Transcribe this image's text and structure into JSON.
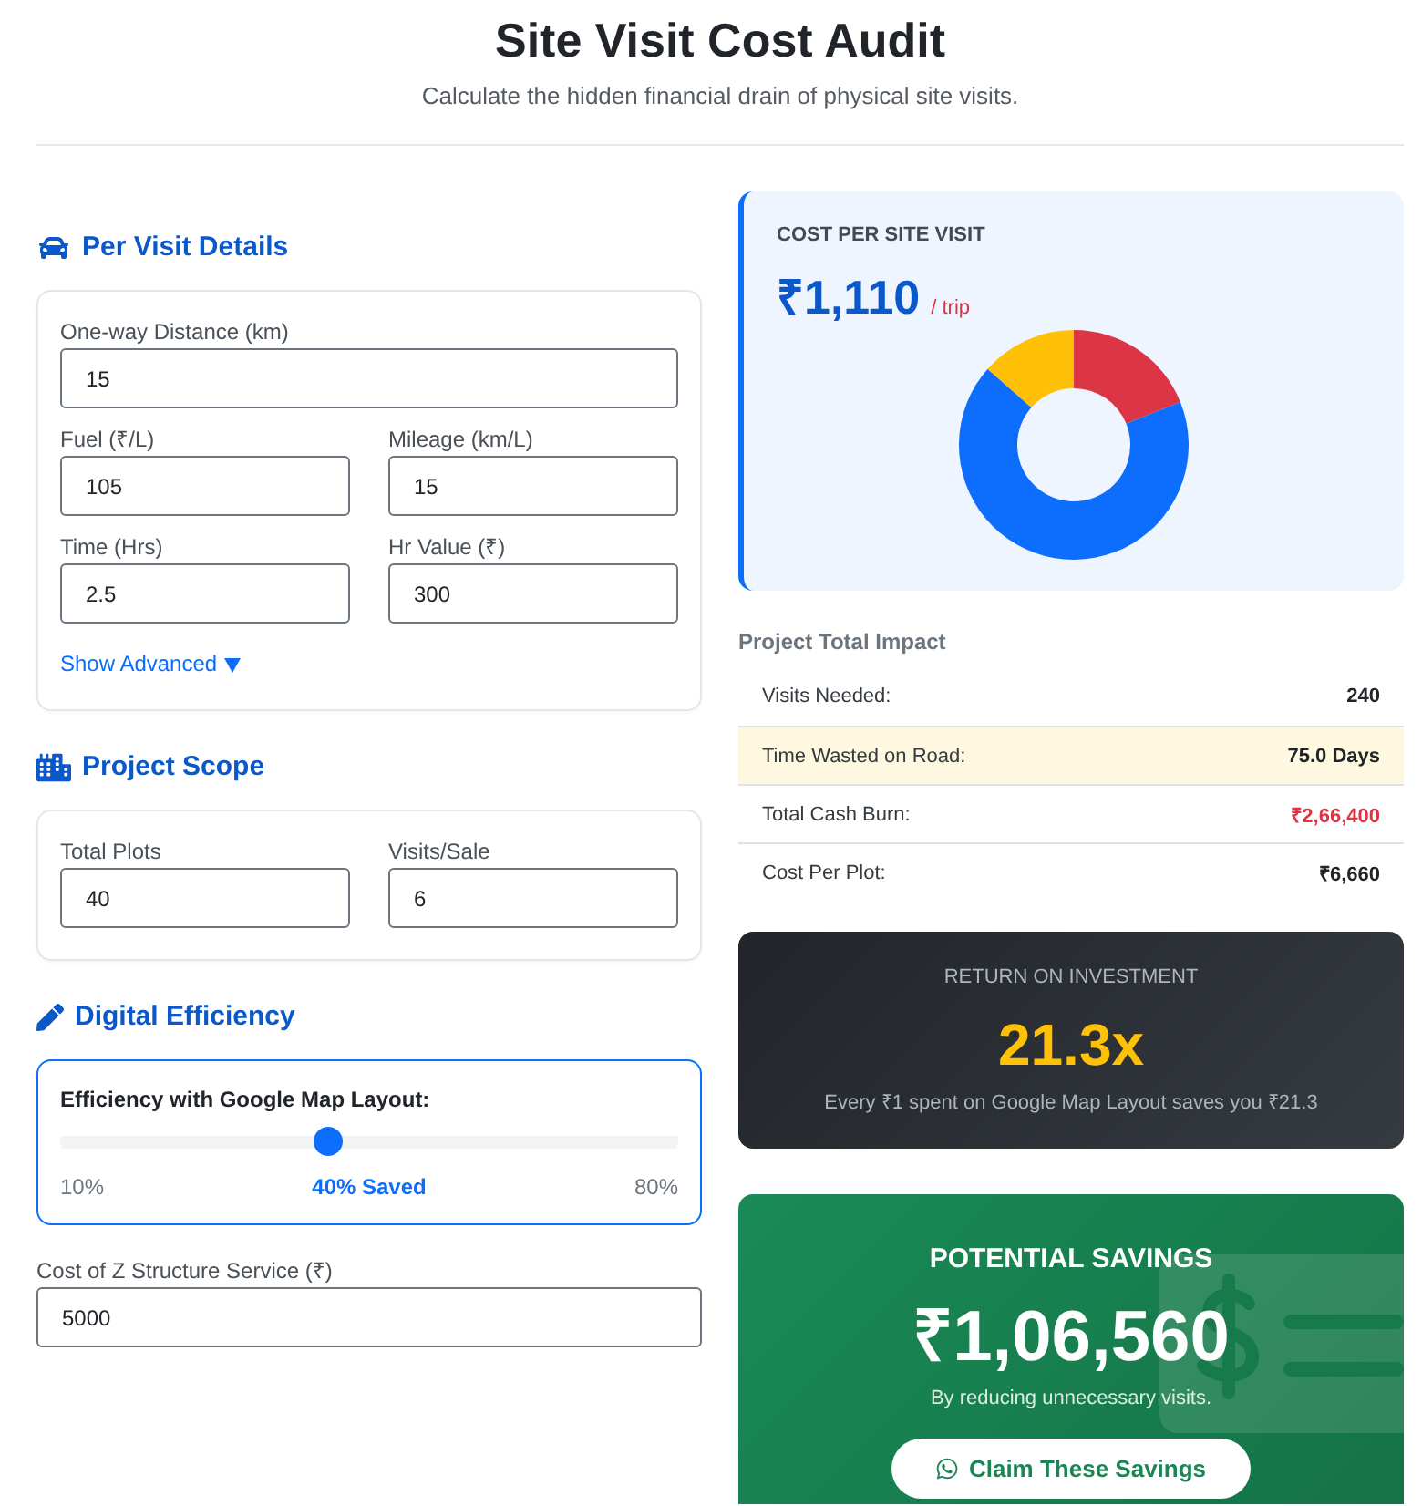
{
  "header": {
    "title": "Site Visit Cost Audit",
    "subtitle": "Calculate the hidden financial drain of physical site visits."
  },
  "per_visit": {
    "heading": "Per Visit Details",
    "rows": [
      {
        "fields": [
          {
            "label": "One-way Distance (km)",
            "value": "15"
          }
        ]
      },
      {
        "fields": [
          {
            "label": "Fuel (₹/L)",
            "value": "105"
          },
          {
            "label": "Mileage (km/L)",
            "value": "15"
          }
        ]
      },
      {
        "fields": [
          {
            "label": "Time (Hrs)",
            "value": "2.5"
          },
          {
            "label": "Hr Value (₹)",
            "value": "300"
          }
        ]
      }
    ],
    "advanced": {
      "label": "Show Advanced",
      "expanded": false
    }
  },
  "project_scope": {
    "heading": "Project Scope",
    "rows": [
      {
        "fields": [
          {
            "label": "Total Plots",
            "value": "40"
          },
          {
            "label": "Visits/Sale",
            "value": "6"
          }
        ]
      }
    ]
  },
  "digital_efficiency": {
    "heading": "Digital Efficiency",
    "slider": {
      "label": "Efficiency with Google Map Layout:",
      "level": 0.43,
      "min_label": "10%",
      "reading": "40% Saved",
      "max_label": "80%"
    },
    "service_cost": {
      "label": "Cost of Z Structure Service (₹)",
      "value": "5000"
    }
  },
  "cost_per_visit": {
    "label": "COST PER SITE VISIT",
    "amount": "₹1,110",
    "unit": "/ trip"
  },
  "project_impact": {
    "heading": "Project Total Impact",
    "rows": [
      {
        "label": "Visits Needed:",
        "value": "240",
        "highlighted": false,
        "color": "#212529"
      },
      {
        "label": "Time Wasted on Road:",
        "value": "75.0 Days",
        "highlighted": true,
        "color": "#212529"
      },
      {
        "label": "Total Cash Burn:",
        "value": "₹2,66,400",
        "highlighted": false,
        "color": "#dc3545"
      },
      {
        "label": "Cost Per Plot:",
        "value": "₹6,660",
        "highlighted": false,
        "color": "#212529"
      }
    ]
  },
  "roi": {
    "label": "RETURN ON INVESTMENT",
    "value": "21.3x",
    "note": "Every ₹1 spent on Google Map Layout saves you ₹21.3"
  },
  "savings": {
    "label": "POTENTIAL SAVINGS",
    "amount": "₹1,06,560",
    "note": "By reducing unnecessary visits.",
    "button": "Claim These Savings"
  }
}
